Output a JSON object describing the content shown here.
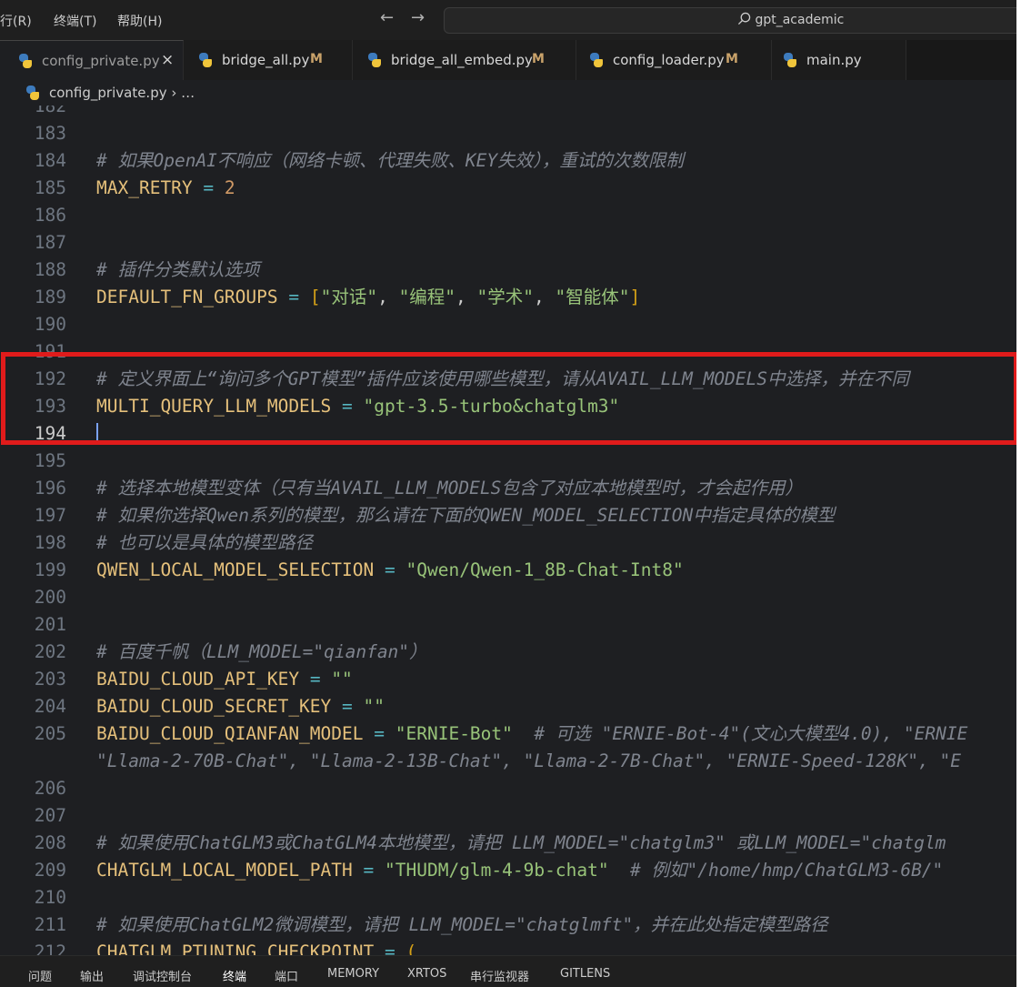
{
  "menu": [
    "行(R)",
    "终端(T)",
    "帮助(H)"
  ],
  "search": {
    "text": "gpt_academic"
  },
  "tabs": [
    {
      "label": "config_private.py",
      "modified": ""
    },
    {
      "label": "bridge_all.py",
      "modified": "M"
    },
    {
      "label": "bridge_all_embed.py",
      "modified": "M"
    },
    {
      "label": "config_loader.py",
      "modified": "M"
    },
    {
      "label": "main.py",
      "modified": ""
    }
  ],
  "breadcrumb": {
    "file": "config_private.py",
    "rest": "…"
  },
  "lines": [
    {
      "n": "182",
      "parts": []
    },
    {
      "n": "183",
      "parts": []
    },
    {
      "n": "184",
      "parts": [
        [
          "c",
          "# 如果OpenAI不响应（网络卡顿、代理失败、KEY失效），重试的次数限制"
        ]
      ]
    },
    {
      "n": "185",
      "parts": [
        [
          "v",
          "MAX_RETRY"
        ],
        [
          "p",
          " "
        ],
        [
          "o",
          "="
        ],
        [
          "p",
          " "
        ],
        [
          "num",
          "2"
        ]
      ]
    },
    {
      "n": "186",
      "parts": []
    },
    {
      "n": "187",
      "parts": []
    },
    {
      "n": "188",
      "parts": [
        [
          "c",
          "# 插件分类默认选项"
        ]
      ]
    },
    {
      "n": "189",
      "parts": [
        [
          "v",
          "DEFAULT_FN_GROUPS"
        ],
        [
          "p",
          " "
        ],
        [
          "o",
          "="
        ],
        [
          "p",
          " "
        ],
        [
          "b",
          "["
        ],
        [
          "s",
          "\"对话\""
        ],
        [
          "p",
          ", "
        ],
        [
          "s",
          "\"编程\""
        ],
        [
          "p",
          ", "
        ],
        [
          "s",
          "\"学术\""
        ],
        [
          "p",
          ", "
        ],
        [
          "s",
          "\"智能体\""
        ],
        [
          "b",
          "]"
        ]
      ]
    },
    {
      "n": "190",
      "parts": []
    },
    {
      "n": "191",
      "parts": []
    },
    {
      "n": "192",
      "parts": [
        [
          "c",
          "# 定义界面上“询问多个GPT模型”插件应该使用哪些模型，请从AVAIL_LLM_MODELS中选择，并在不同"
        ]
      ]
    },
    {
      "n": "193",
      "parts": [
        [
          "v",
          "MULTI_QUERY_LLM_MODELS"
        ],
        [
          "p",
          " "
        ],
        [
          "o",
          "="
        ],
        [
          "p",
          " "
        ],
        [
          "s",
          "\"gpt-3.5-turbo&chatglm3\""
        ]
      ]
    },
    {
      "n": "194",
      "parts": []
    },
    {
      "n": "195",
      "parts": []
    },
    {
      "n": "196",
      "parts": [
        [
          "c",
          "# 选择本地模型变体（只有当AVAIL_LLM_MODELS包含了对应本地模型时，才会起作用）"
        ]
      ]
    },
    {
      "n": "197",
      "parts": [
        [
          "c",
          "# 如果你选择Qwen系列的模型，那么请在下面的QWEN_MODEL_SELECTION中指定具体的模型"
        ]
      ]
    },
    {
      "n": "198",
      "parts": [
        [
          "c",
          "# 也可以是具体的模型路径"
        ]
      ]
    },
    {
      "n": "199",
      "parts": [
        [
          "v",
          "QWEN_LOCAL_MODEL_SELECTION"
        ],
        [
          "p",
          " "
        ],
        [
          "o",
          "="
        ],
        [
          "p",
          " "
        ],
        [
          "s",
          "\"Qwen/Qwen-1_8B-Chat-Int8\""
        ]
      ]
    },
    {
      "n": "200",
      "parts": []
    },
    {
      "n": "201",
      "parts": []
    },
    {
      "n": "202",
      "parts": [
        [
          "c",
          "# 百度千帆（LLM_MODEL=\"qianfan\"）"
        ]
      ]
    },
    {
      "n": "203",
      "parts": [
        [
          "v",
          "BAIDU_CLOUD_API_KEY"
        ],
        [
          "p",
          " "
        ],
        [
          "o",
          "="
        ],
        [
          "p",
          " "
        ],
        [
          "s",
          "\"\""
        ]
      ]
    },
    {
      "n": "204",
      "parts": [
        [
          "v",
          "BAIDU_CLOUD_SECRET_KEY"
        ],
        [
          "p",
          " "
        ],
        [
          "o",
          "="
        ],
        [
          "p",
          " "
        ],
        [
          "s",
          "\"\""
        ]
      ]
    },
    {
      "n": "205",
      "parts": [
        [
          "v",
          "BAIDU_CLOUD_QIANFAN_MODEL"
        ],
        [
          "p",
          " "
        ],
        [
          "o",
          "="
        ],
        [
          "p",
          " "
        ],
        [
          "s",
          "\"ERNIE-Bot\""
        ],
        [
          "p",
          "  "
        ],
        [
          "c",
          "# 可选 \"ERNIE-Bot-4\"(文心大模型4.0), \"ERNIE"
        ]
      ]
    },
    {
      "n": "",
      "parts": [
        [
          "c",
          "\"Llama-2-70B-Chat\", \"Llama-2-13B-Chat\", \"Llama-2-7B-Chat\", \"ERNIE-Speed-128K\", \"E"
        ]
      ]
    },
    {
      "n": "206",
      "parts": []
    },
    {
      "n": "207",
      "parts": []
    },
    {
      "n": "208",
      "parts": [
        [
          "c",
          "# 如果使用ChatGLM3或ChatGLM4本地模型，请把 LLM_MODEL=\"chatglm3\" 或LLM_MODEL=\"chatglm"
        ]
      ]
    },
    {
      "n": "209",
      "parts": [
        [
          "v",
          "CHATGLM_LOCAL_MODEL_PATH"
        ],
        [
          "p",
          " "
        ],
        [
          "o",
          "="
        ],
        [
          "p",
          " "
        ],
        [
          "s",
          "\"THUDM/glm-4-9b-chat\""
        ],
        [
          "p",
          "  "
        ],
        [
          "c",
          "# 例如\"/home/hmp/ChatGLM3-6B/\""
        ]
      ]
    },
    {
      "n": "210",
      "parts": []
    },
    {
      "n": "211",
      "parts": [
        [
          "c",
          "# 如果使用ChatGLM2微调模型，请把 LLM_MODEL=\"chatglmft\"，并在此处指定模型路径"
        ]
      ]
    },
    {
      "n": "212",
      "parts": [
        [
          "v",
          "CHATGLM_PTUNING_CHECKPOINT"
        ],
        [
          "p",
          " "
        ],
        [
          "o",
          "="
        ],
        [
          "p",
          " "
        ],
        [
          "b",
          "("
        ]
      ]
    }
  ],
  "current_line": "194",
  "panel_tabs": [
    "问题",
    "输出",
    "调试控制台",
    "终端",
    "端口",
    "MEMORY",
    "XRTOS",
    "串行监视器",
    "GITLENS"
  ],
  "active_panel_tab": "终端",
  "colors": {
    "highlight_box": "#e01b1b",
    "variable": "#e5c07b",
    "string": "#98c379",
    "comment": "#7f848e",
    "operator": "#56b6c2",
    "number": "#d19a66"
  }
}
